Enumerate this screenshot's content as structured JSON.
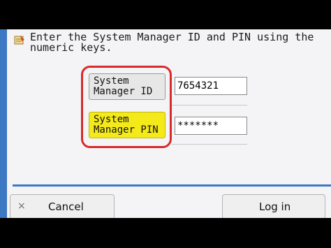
{
  "dialog": {
    "instruction": "Enter the System Manager ID and PIN using the numeric keys.",
    "icon": "note-icon"
  },
  "fields": {
    "id_label": "System Manager ID",
    "id_value": "7654321",
    "pin_label": "System Manager PIN",
    "pin_value": "*******"
  },
  "buttons": {
    "cancel_icon": "×",
    "cancel_label": "Cancel",
    "login_label": "Log in"
  },
  "colors": {
    "active_field": "#f4ea1a",
    "highlight_ring": "#d82a2a",
    "accent_blue": "#3d78c2"
  }
}
